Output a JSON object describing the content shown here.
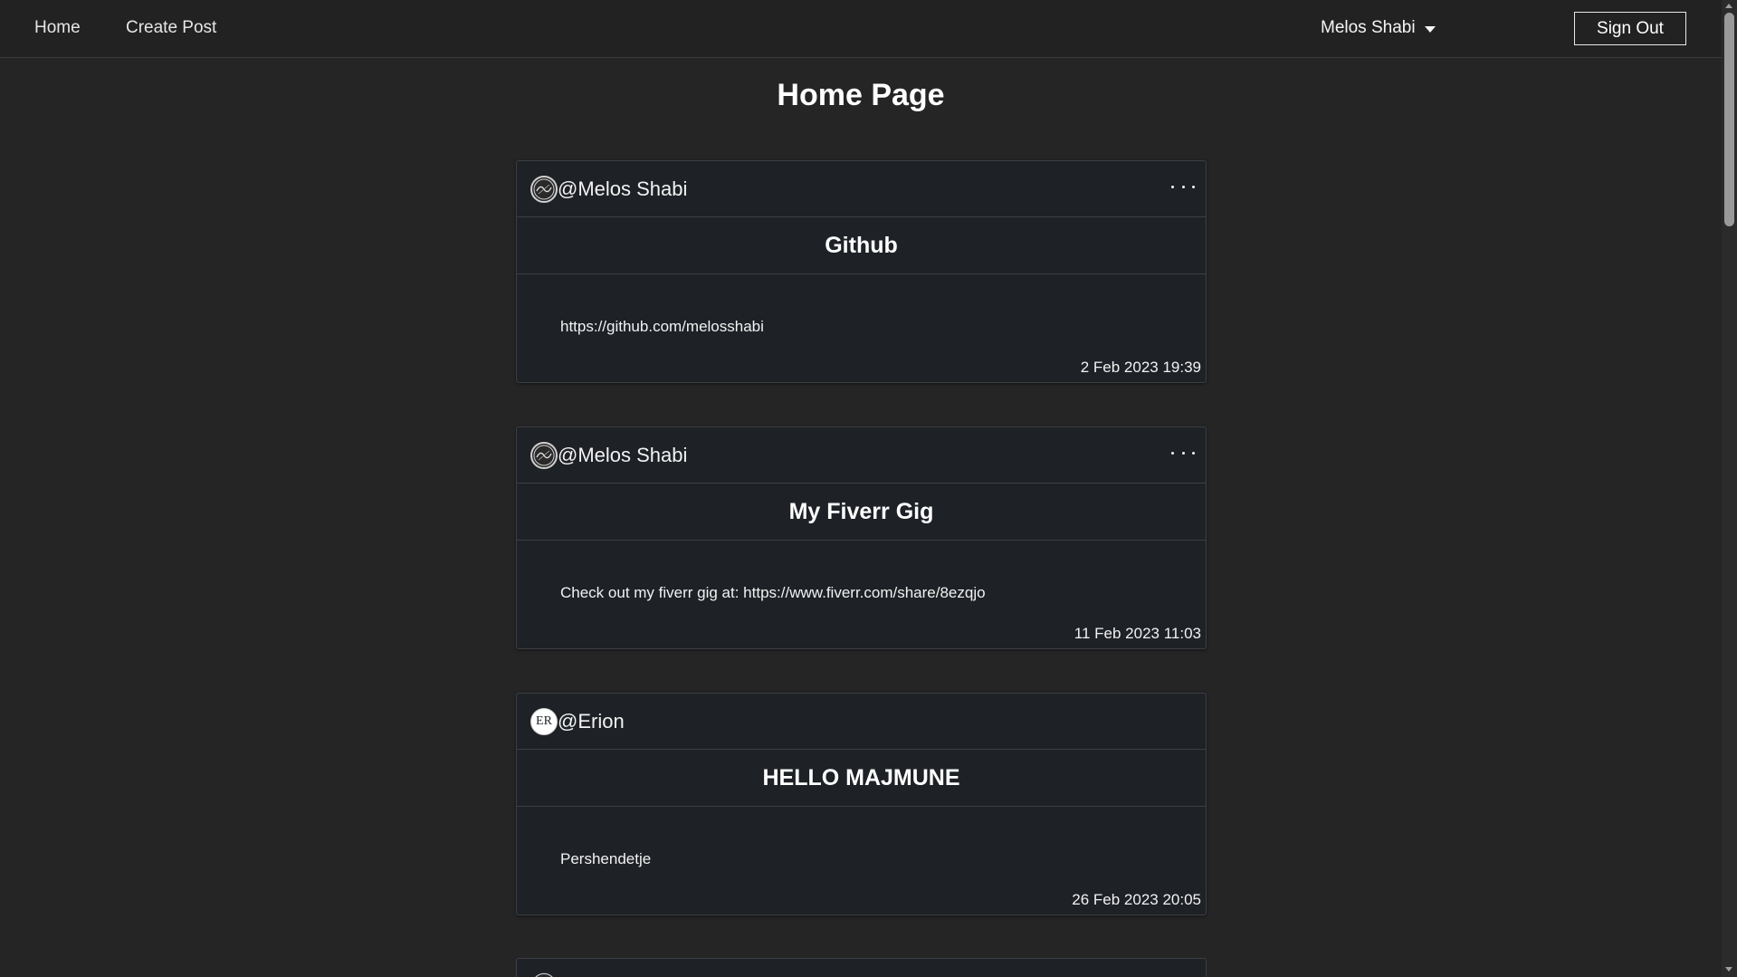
{
  "nav": {
    "home_label": "Home",
    "create_post_label": "Create Post",
    "user_name": "Melos Shabi",
    "sign_out_label": "Sign Out"
  },
  "page": {
    "title": "Home Page"
  },
  "posts": [
    {
      "author": "@Melos Shabi",
      "avatar": "logo-avatar",
      "has_menu": true,
      "title": "Github",
      "text": "https://github.com/melosshabi",
      "date": "2 Feb 2023 19:39"
    },
    {
      "author": "@Melos Shabi",
      "avatar": "logo-avatar",
      "has_menu": true,
      "title": "My Fiverr Gig",
      "text": "Check out my fiverr gig at: https://www.fiverr.com/share/8ezqjo",
      "date": "11 Feb 2023 11:03"
    },
    {
      "author": "@Erion",
      "avatar": "ER",
      "has_menu": false,
      "title": "HELLO MAJMUNE",
      "text": "Pershendetje",
      "date": "26 Feb 2023 20:05"
    }
  ],
  "colors": {
    "background": "#252525",
    "navbar": "#222222",
    "card": "#1e2126",
    "border": "#3c3f44",
    "text": "#f2f2f2"
  },
  "icons": {
    "more_menu": "more-horizontal-icon",
    "dropdown": "caret-down-icon",
    "avatar_logo": "logo-avatar-icon"
  }
}
